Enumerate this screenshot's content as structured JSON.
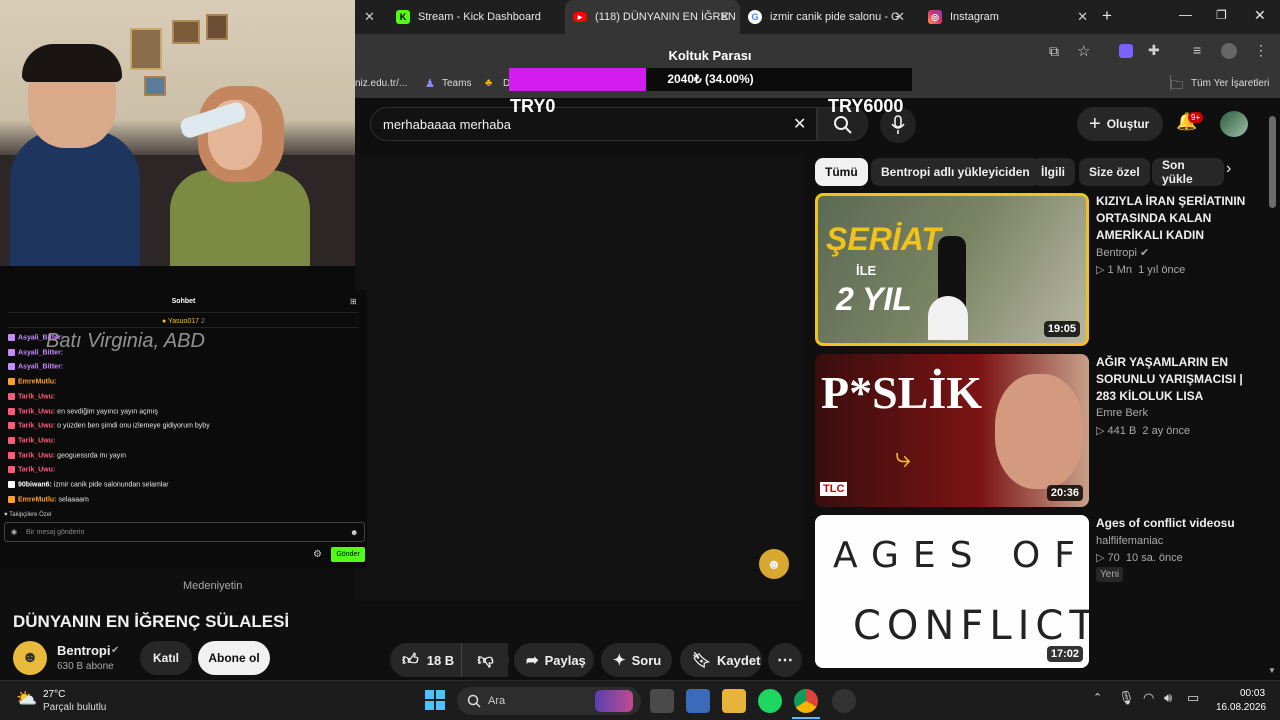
{
  "tabs": [
    {
      "label": "Stream - Kick Dashboard",
      "icon": "kick-icon"
    },
    {
      "label": "(118) DÜNYANIN EN İĞREN",
      "icon": "youtube-icon",
      "active": true
    },
    {
      "label": "izmir canik pide salonu - G",
      "icon": "google-icon"
    },
    {
      "label": "Instagram",
      "icon": "instagram-icon"
    }
  ],
  "bookmarks": {
    "partial_url": "niz.edu.tr/...",
    "teams": "Teams",
    "d_item": "D",
    "all_bookmarks": "Tüm Yer İşaretleri"
  },
  "donation": {
    "title": "Koltuk Parası",
    "value_text": "2040₺ (34.00%)",
    "progress": 0.34,
    "min_label": "TRY0",
    "max_label": "TRY6000",
    "fill_color": "#d21cf0"
  },
  "youtube": {
    "search_value": "merhabaaaa merhaba",
    "create_label": "Oluştur",
    "notif_count": "9+",
    "chips": [
      "Tümü",
      "Bentropi adlı yükleyiciden",
      "İlgili",
      "Size özel",
      "Son yükle"
    ],
    "player_caption": "Medeniyetin",
    "video_title": "DÜNYANIN EN İĞRENÇ SÜLALESİ",
    "channel_name": "Bentropi",
    "subscribers": "630 B abone",
    "join_label": "Katıl",
    "subscribe_label": "Abone ol",
    "like_count": "18 B",
    "share_label": "Paylaş",
    "ask_label": "Soru",
    "save_label": "Kaydet",
    "recommendations": [
      {
        "title": "KIZIYLA İRAN ŞERİATININ ORTASINDA KALAN AMERİKALI KADIN",
        "channel": "Bentropi",
        "views": "1 Mn",
        "age": "1 yıl önce",
        "duration": "19:05",
        "thumb_text_1": "ŞERİAT",
        "thumb_text_2": "İLE",
        "thumb_text_3": "2 YIL"
      },
      {
        "title": "AĞIR YAŞAMLARIN EN SORUNLU YARIŞMACISI | 283 KİLOLUK LISA",
        "channel": "Emre Berk",
        "views": "441 B",
        "age": "2 ay önce",
        "duration": "20:36",
        "thumb_text_1": "P*SLİK",
        "thumb_text_2": "TLC"
      },
      {
        "title": "Ages of conflict videosu",
        "channel": "halflifemaniac",
        "views": "70",
        "age": "10 sa. önce",
        "badge": "Yeni",
        "duration": "17:02",
        "thumb_text_1": "AGES OF",
        "thumb_text_2": "CONFLICT"
      }
    ]
  },
  "chat": {
    "header": "Sohbet",
    "pinned_user": "Yasuo017",
    "pinned_count": "2",
    "overlay_location": "Batı Virginia, ABD",
    "messages": [
      {
        "user": "Asyali_Bitter:",
        "text": "",
        "color": "#c58bff"
      },
      {
        "user": "Asyali_Bitter:",
        "text": "",
        "color": "#c58bff"
      },
      {
        "user": "Asyali_Bitter:",
        "text": "",
        "color": "#c58bff"
      },
      {
        "user": "EmreMutlu:",
        "text": "",
        "color": "#ff9f2e"
      },
      {
        "user": "Tarik_Uwu:",
        "text": "",
        "color": "#ff5a7a"
      },
      {
        "user": "Tarik_Uwu:",
        "text": "en sevdiğim yayıncı yayın açmış",
        "color": "#ff5a7a"
      },
      {
        "user": "Tarik_Uwu:",
        "text": "o yüzden ben şimdi onu izlemeye gidiyorum byby",
        "color": "#ff5a7a"
      },
      {
        "user": "Tarik_Uwu:",
        "text": "",
        "color": "#ff5a7a"
      },
      {
        "user": "Tarik_Uwu:",
        "text": "geoguessrda mı yayın",
        "color": "#ff5a7a"
      },
      {
        "user": "Tarik_Uwu:",
        "text": "",
        "color": "#ff5a7a"
      },
      {
        "user": "90biwan6:",
        "text": "izmir canik pide salonundan selamlar",
        "color": "#ffffff"
      },
      {
        "user": "EmreMutlu:",
        "text": "selaaaam",
        "color": "#ff9f2e"
      }
    ],
    "followers_only": "Takipçilere Özel",
    "input_placeholder": "Bir mesaj gönderin",
    "send_label": "Gönder"
  },
  "taskbar": {
    "temperature": "27°C",
    "weather": "Parçalı bulutlu",
    "search_placeholder": "Ara",
    "time": "00:03",
    "date": "16.08.2026"
  }
}
